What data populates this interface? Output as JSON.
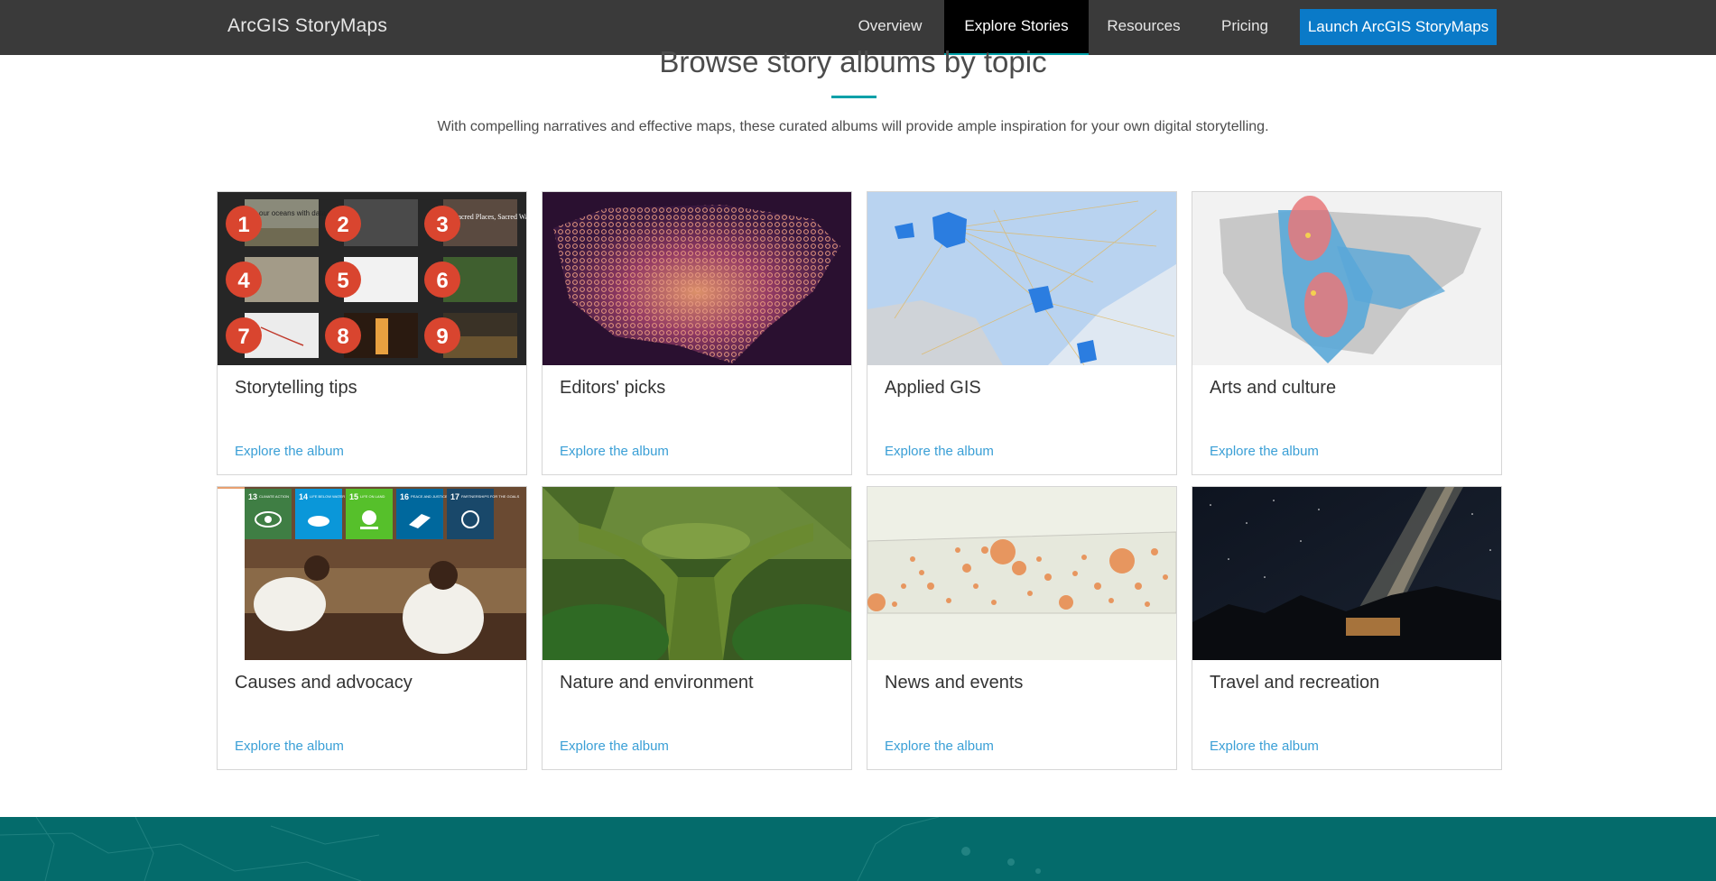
{
  "nav": {
    "brand": "ArcGIS StoryMaps",
    "links": [
      "Overview",
      "Explore Stories",
      "Resources",
      "Pricing"
    ],
    "launch_label": "Launch ArcGIS StoryMaps"
  },
  "section": {
    "title": "Browse story albums by topic",
    "intro": "With compelling narratives and effective maps, these curated albums will provide ample inspiration for your own digital storytelling."
  },
  "albums": [
    {
      "title": "Storytelling tips",
      "link": "Explore the album"
    },
    {
      "title": "Editors' picks",
      "link": "Explore the album"
    },
    {
      "title": "Applied GIS",
      "link": "Explore the album"
    },
    {
      "title": "Arts and culture",
      "link": "Explore the album"
    },
    {
      "title": "Causes and advocacy",
      "link": "Explore the album"
    },
    {
      "title": "Nature and environment",
      "link": "Explore the album"
    },
    {
      "title": "News and events",
      "link": "Explore the album"
    },
    {
      "title": "Travel and recreation",
      "link": "Explore the album"
    }
  ],
  "thumb_text": {
    "tips_numbers": [
      "1",
      "2",
      "3",
      "4",
      "5",
      "6",
      "7",
      "8",
      "9"
    ],
    "tips_caption_1": "our oceans with data",
    "tips_caption_3": "Sacred Places, Sacred Ways",
    "sdg_tiles": [
      {
        "num": "13",
        "label": "CLIMATE ACTION"
      },
      {
        "num": "14",
        "label": "LIFE BELOW WATER"
      },
      {
        "num": "15",
        "label": "LIFE ON LAND"
      },
      {
        "num": "16",
        "label": "PEACE AND JUSTICE"
      },
      {
        "num": "17",
        "label": "PARTNERSHIPS FOR THE GOALS"
      }
    ]
  },
  "colors": {
    "nav_bg": "#3a3a3a",
    "nav_active_bg": "#000000",
    "accent_teal": "#00a0a8",
    "launch_blue": "#0a7ac8",
    "link_blue": "#3a9fd6",
    "footer_teal": "#046b6b",
    "tips_badge": "#d9452f"
  }
}
